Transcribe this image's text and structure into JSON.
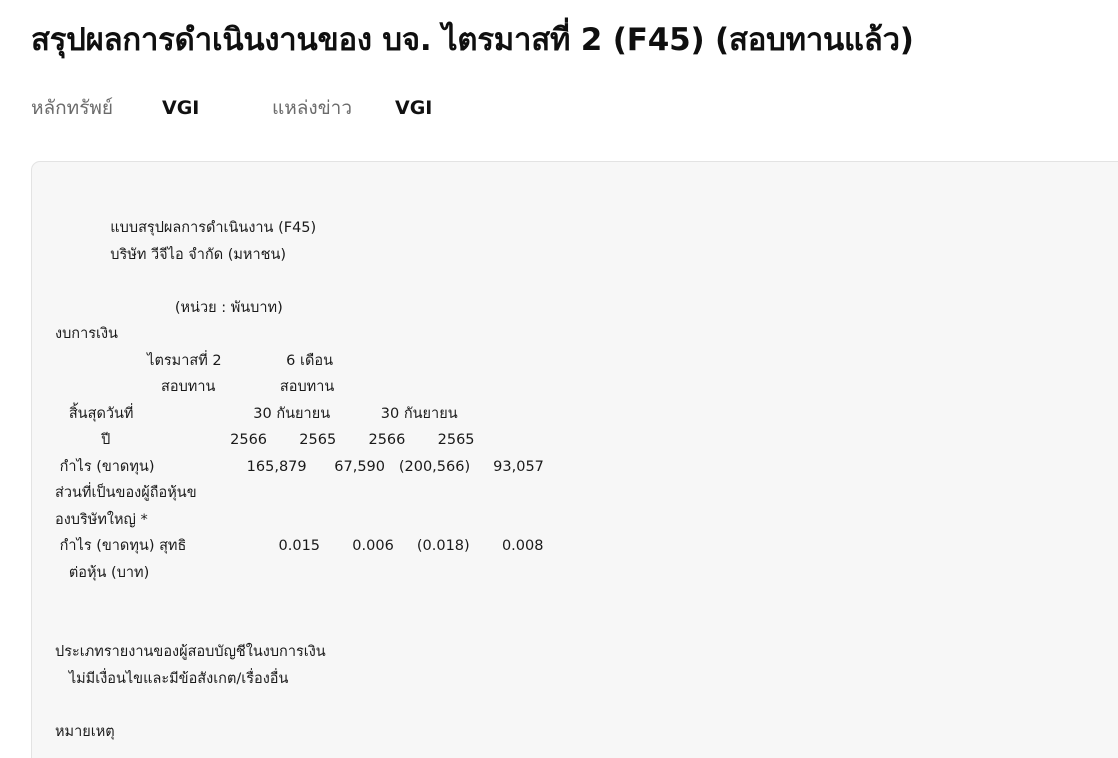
{
  "page": {
    "title": "สรุปผลการดำเนินงานของ บจ. ไตรมาสที่ 2 (F45) (สอบทานแล้ว)"
  },
  "meta": {
    "security_label": "หลักทรัพย์",
    "security_value": "VGI",
    "source_label": "แหล่งข่าว",
    "source_value": "VGI"
  },
  "content": {
    "lines": [
      "            แบบสรุปผลการดำเนินงาน (F45)",
      "            บริษัท วีจีไอ จำกัด (มหาชน)",
      "",
      "                          (หน่วย : พันบาท)",
      "งบการเงิน",
      "                    ไตรมาสที่ 2              6 เดือน",
      "                       สอบทาน              สอบทาน",
      "   สิ้นสุดวันที่                          30 กันยายน           30 กันยายน",
      "          ปี                          2566       2565       2566       2565",
      " กำไร (ขาดทุน)                    165,879      67,590   (200,566)     93,057",
      "ส่วนที่เป็นของผู้ถือหุ้นข",
      "องบริษัทใหญ่ *",
      " กำไร (ขาดทุน) สุทธิ                    0.015       0.006     (0.018)       0.008",
      "   ต่อหุ้น (บาท)",
      "",
      "",
      "ประเภทรายงานของผู้สอบบัญชีในงบการเงิน",
      "   ไม่มีเงื่อนไขและมีข้อสังเกต/เรื่องอื่น",
      "",
      "หมายเหตุ"
    ]
  }
}
